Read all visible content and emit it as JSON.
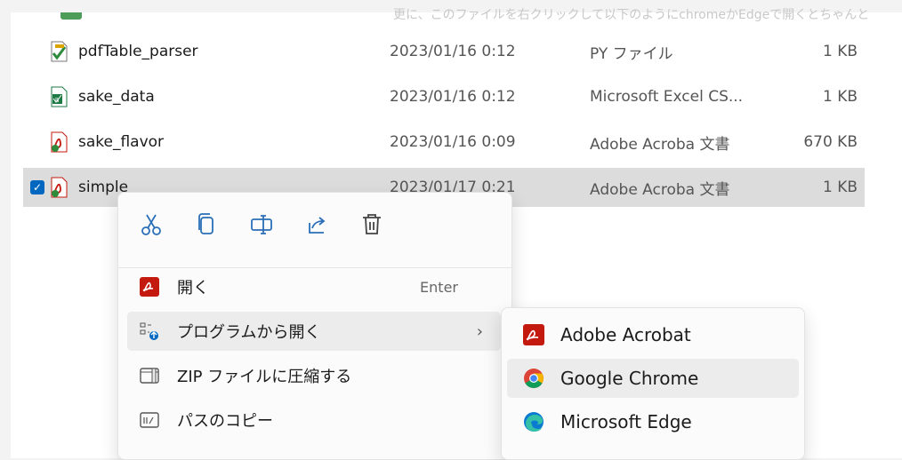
{
  "background_text": "更に、このファイルを右クリックして以下のようにchromeかEdgeで開くとちゃんと",
  "files": [
    {
      "name": "pdfTable_parser",
      "date": "2023/01/16 0:12",
      "type": "PY ファイル",
      "size": "1 KB",
      "icon": "python-file-icon"
    },
    {
      "name": "sake_data",
      "date": "2023/01/16 0:12",
      "type": "Microsoft Excel CS...",
      "size": "1 KB",
      "icon": "excel-csv-icon"
    },
    {
      "name": "sake_flavor",
      "date": "2023/01/16 0:09",
      "type": "Adobe Acroba 文書",
      "size": "670 KB",
      "icon": "pdf-file-icon"
    },
    {
      "name": "simple",
      "date": "2023/01/17 0:21",
      "type": "Adobe Acroba 文書",
      "size": "1 KB",
      "icon": "pdf-file-icon",
      "selected": true
    }
  ],
  "context_menu": {
    "toolbar": [
      "cut-icon",
      "copy-icon",
      "rename-icon",
      "share-icon",
      "delete-icon"
    ],
    "items": [
      {
        "label": "開く",
        "shortcut": "Enter",
        "icon": "acrobat-icon"
      },
      {
        "label": "プログラムから開く",
        "chevron": "›",
        "icon": "open-with-icon"
      },
      {
        "label": "ZIP ファイルに圧縮する",
        "icon": "zip-icon"
      },
      {
        "label": "パスのコピー",
        "icon": "copy-path-icon"
      }
    ]
  },
  "submenu": {
    "items": [
      {
        "label": "Adobe Acrobat",
        "icon": "acrobat-icon"
      },
      {
        "label": "Google Chrome",
        "icon": "chrome-icon"
      },
      {
        "label": "Microsoft Edge",
        "icon": "edge-icon"
      }
    ]
  },
  "colors": {
    "accent": "#0067c0",
    "acrobat": "#c4190e",
    "selection": "#dcdcdc"
  }
}
